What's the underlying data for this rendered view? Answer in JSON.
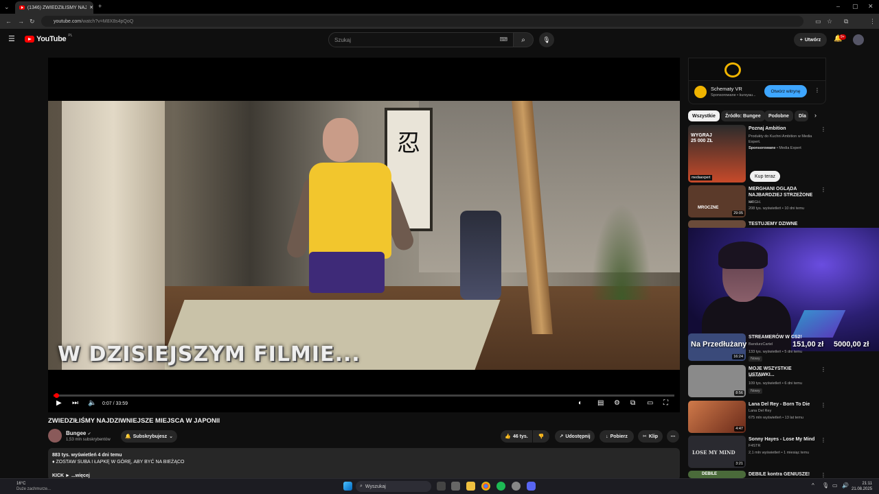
{
  "browser": {
    "tab_title": "(1346) ZWIEDZIŁIŚMY NAJDZIW...",
    "url_host": "youtube.com",
    "url_path": "/watch?v=M8X8s4pQoQ"
  },
  "header": {
    "logo_text": "YouTube",
    "logo_region": "PL",
    "search_placeholder": "Szukaj",
    "create_label": "Utwórz",
    "notif_count": "9+"
  },
  "player": {
    "overlay_text": "W DZISIEJSZYM FILMIE...",
    "time_current": "0:07",
    "time_total": "33:59",
    "progress_fraction": 0.004,
    "scroll_char": "忍"
  },
  "video": {
    "title": "ZWIEDZIŁIŚMY NAJDZIWNIEJSZE MIEJSCA W JAPONII",
    "channel": "Bungee",
    "subscribers": "1,53 mln subskrybentów",
    "subscribed_label": "Subskrybujesz",
    "likes": "46 tys.",
    "share_label": "Udostępnij",
    "download_label": "Pobierz",
    "clip_label": "Klip",
    "views_date": "883 tys. wyświetleń  4 dni temu",
    "desc_line": "♦ ZOSTAW SUBA I ŁAPKĘ W GÓRĘ, ABY BYĆ NA BIEŻĄCO",
    "desc_more_prefix": "KICK ►",
    "desc_more": "...więcej"
  },
  "ad": {
    "name": "Schematy VR",
    "meta": "Sponsorowane • kursyau...",
    "cta": "Otwórz witrynę"
  },
  "chips": [
    "Wszystkie",
    "Źródło: Bungee",
    "Podobne",
    "Dla"
  ],
  "promo": {
    "title": "Poznaj Ambition",
    "desc": "Produkty do Kuchni Ambition w Media Expert.",
    "sponsor": "Sponsorowane",
    "sponsor_name": "• Media Expert",
    "cta": "Kup teraz",
    "thumb_text": "WYGRAJ 25 000 ZŁ",
    "thumb_brand": "mediaexpert"
  },
  "recs": [
    {
      "title": "MERGHANI OGLĄDA NAJBARDZIEJ STRZEŻONE ...",
      "channel": "MRGH.",
      "meta": "208 tys. wyświetleń • 10 dni temu",
      "duration": "29:05",
      "color": "#5b3a2a"
    },
    {
      "title": "TESTUJEMY DZIWNE JEDZENIE",
      "channel": "",
      "meta": "",
      "duration": "",
      "color": "#6a4b3a"
    },
    {
      "title": "STREAMERÓW W CS2!",
      "channel": "BandurzCartel",
      "meta": "133 tys. wyświetleń • 5 dni temu",
      "duration": "16:24",
      "badge": "Nowy",
      "color": "#3a4a7a"
    },
    {
      "title": "MOJE WSZYSTKIE USTAWKI...",
      "channel": "qwerstn",
      "meta": "109 tys. wyświetleń • 6 dni temu",
      "duration": "8:56",
      "badge": "Nowy",
      "color": "#8a8a8a"
    },
    {
      "title": "Lana Del Rey - Born To Die",
      "channel": "Lana Del Rey",
      "meta": "675 mln wyświetleń • 13 lat temu",
      "duration": "4:47",
      "color": "#b0523a"
    },
    {
      "title": "Sonny Hayes - Lose My Mind",
      "channel": "F4STR",
      "meta": "2,1 mln wyświetleń • 1 miesiąc temu",
      "duration": "3:21",
      "color": "#2a2a30"
    },
    {
      "title": "DEBILE kontra GENIUSZE!",
      "channel": "",
      "meta": "",
      "duration": "",
      "color": "#4a6a3a"
    }
  ],
  "rec_thumb_texts": {
    "mroczne": "MROCZNE",
    "lose": "LOSE MY MIND",
    "debile": "DEBILE"
  },
  "donation": {
    "label": "Na Przedłużany",
    "current": "151,00 zł",
    "goal": "5000,00 zł"
  },
  "taskbar": {
    "temp": "16°C",
    "weather": "Duże zachmurze...",
    "search": "Wyszukaj",
    "time": "21:11",
    "date": "21.08.2025"
  },
  "colors": {
    "accent_red": "#ff0000",
    "link_blue": "#3ea6ff",
    "bg": "#0f0f0f"
  }
}
